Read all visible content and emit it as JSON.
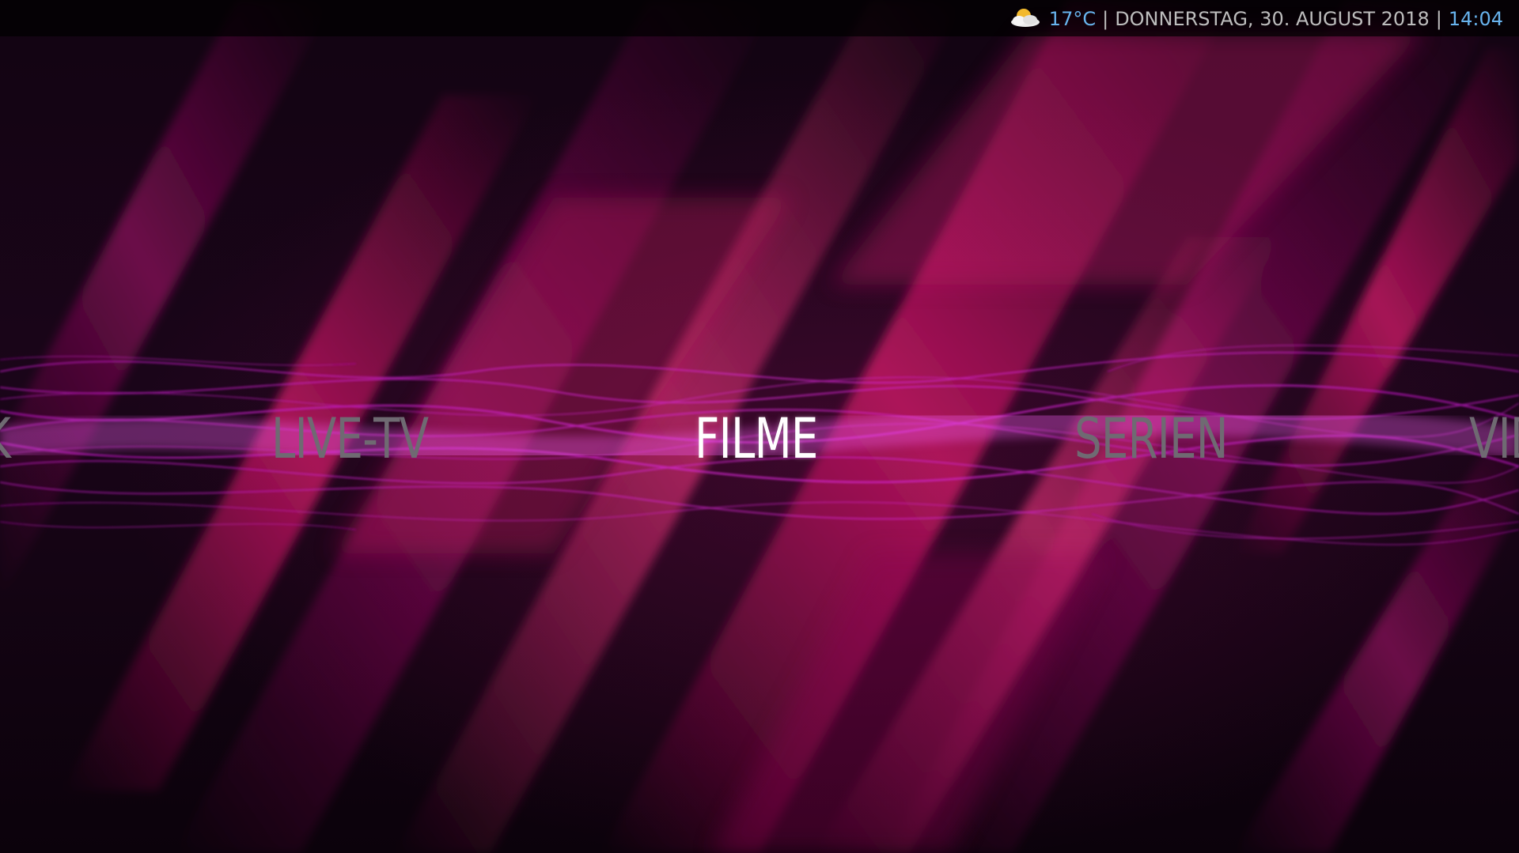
{
  "status_bar": {
    "weather_icon": "partly-cloudy-sun-icon",
    "temperature": "17°C",
    "separator": "|",
    "date": "DONNERSTAG, 30. AUGUST 2018",
    "time": "14:04"
  },
  "main_menu": {
    "items": [
      {
        "label": "K",
        "state": "partially-visible"
      },
      {
        "label": "LIVE-TV",
        "state": "normal"
      },
      {
        "label": "FILME",
        "state": "focused"
      },
      {
        "label": "SERIEN",
        "state": "normal"
      },
      {
        "label": "VID",
        "state": "partially-visible"
      }
    ]
  },
  "colors": {
    "accent": "#68b4ee",
    "focused_text": "#ffffff",
    "unfocused_text": "#6f6a72",
    "wave": "#c51fc9",
    "background_streak": "#c4105e"
  }
}
